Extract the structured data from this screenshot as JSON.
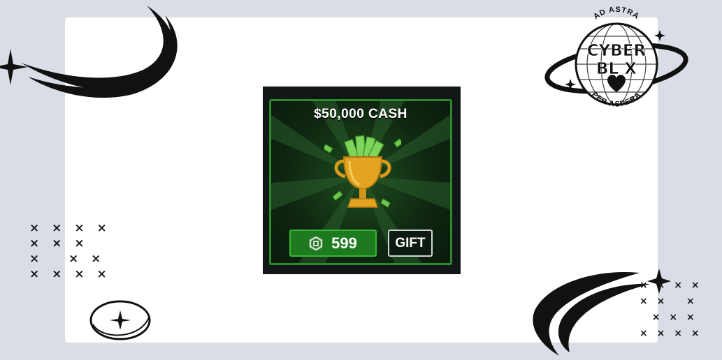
{
  "product": {
    "title": "$50,000 CASH",
    "price": "599",
    "gift_label": "GIFT",
    "currency_icon": "robux-icon",
    "image_icon": "trophy-cash-icon"
  },
  "logo": {
    "top_text": "AD ASTRA",
    "main_line1": "CYBER",
    "main_line2": "BL X",
    "bottom_text": "PER ASPERA"
  },
  "colors": {
    "background": "#d9dee6",
    "card": "#ffffff",
    "accent_green": "#2d8a2a",
    "button_green": "#1e7a1f",
    "dark": "#111716"
  }
}
